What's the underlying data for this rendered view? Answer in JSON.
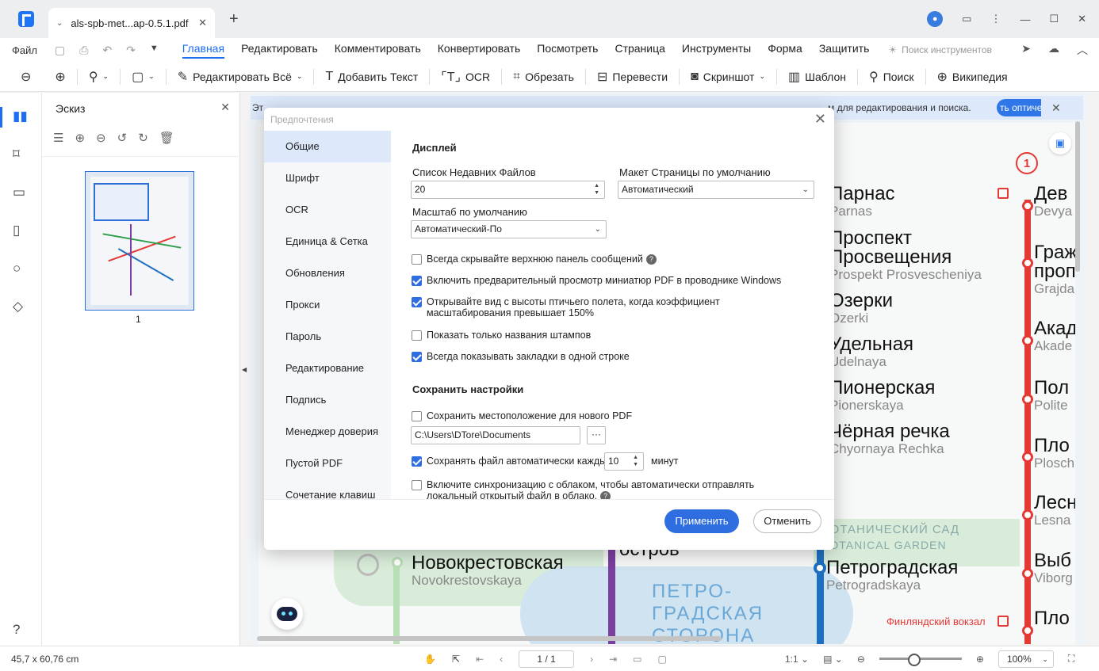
{
  "titlebar": {
    "tab_title": "als-spb-met...ap-0.5.1.pdf",
    "tab_close": "✕",
    "new_tab": "+"
  },
  "menubar": {
    "file": "Файл",
    "items": [
      "Главная",
      "Редактировать",
      "Комментировать",
      "Конвертировать",
      "Посмотреть",
      "Страница",
      "Инструменты",
      "Форма",
      "Защитить"
    ],
    "active_item": "Главная",
    "tool_search_placeholder": "Поиск инструментов"
  },
  "toolbar": {
    "edit_all": "Редактировать Всё",
    "add_text": "Добавить Текст",
    "ocr": "OCR",
    "crop": "Обрезать",
    "translate": "Перевести",
    "screenshot": "Скриншот",
    "template": "Шаблон",
    "search": "Поиск",
    "wiki": "Википедия"
  },
  "thumbnail_panel": {
    "title": "Эскиз",
    "page_number": "1"
  },
  "banner": {
    "text_start": "Эт",
    "text_end": "м для редактирования и поиска.",
    "button": "ть оптиче"
  },
  "map": {
    "line_number": "1",
    "stations_left": [
      {
        "ru": "Парнас",
        "lat": "Parnas"
      },
      {
        "ru": "Проспект",
        "ru2": "Просвещения",
        "lat": "Prospekt Prosvescheniya"
      },
      {
        "ru": "Озерки",
        "lat": "Ozerki"
      },
      {
        "ru": "Удельная",
        "lat": "Udelnaya"
      },
      {
        "ru": "Пионерская",
        "lat": "Pionerskaya"
      },
      {
        "ru": "Чёрная речка",
        "lat": "Chyornaya Rechka"
      }
    ],
    "stations_right": [
      {
        "ru": "Дев",
        "lat": "Devya"
      },
      {
        "ru": "Граж",
        "ru2": "проп",
        "lat": "Grajda"
      },
      {
        "ru": "Акад",
        "lat": "Akade"
      },
      {
        "ru": "Пол",
        "lat": "Polite"
      },
      {
        "ru": "Пло",
        "lat": "Plosch"
      },
      {
        "ru": "Лесн",
        "lat": "Lesna"
      },
      {
        "ru": "Выб",
        "lat": "Viborg"
      },
      {
        "ru": "Пло",
        "lat": ""
      }
    ],
    "botanical_ru": "БОТАНИЧЕСКИЙ САД",
    "botanical_en": "BOTANICAL GARDEN",
    "novokrest_ru": "Новокрестовская",
    "novokrest_lat": "Novokrestovskaya",
    "ostrov": "остров",
    "petrogradskaya_ru": "Петроградская",
    "petrogradskaya_lat": "Petrogradskaya",
    "district_1": "ПЕТРО-",
    "district_2": "ГРАДСКАЯ",
    "district_3": "СТОРОНА",
    "finland_station": "Финляндский вокзал"
  },
  "statusbar": {
    "page_size": "45,7 x 60,76 cm",
    "page_indicator": "1 / 1",
    "zoom": "100%",
    "zoom_slider_fraction": 0.35
  },
  "dialog": {
    "title": "Предпочтения",
    "nav": [
      "Общие",
      "Шрифт",
      "OCR",
      "Единица & Сетка",
      "Обновления",
      "Прокси",
      "Пароль",
      "Редактирование",
      "Подпись",
      "Менеджер доверия",
      "Пустой PDF",
      "Сочетание клавиш"
    ],
    "active_nav": "Общие",
    "display_section": "Дисплей",
    "recent_files_label": "Список Недавних Файлов",
    "recent_files_value": "20",
    "layout_label": "Макет Страницы по умолчанию",
    "layout_value": "Автоматический",
    "zoom_label": "Масштаб по умолчанию",
    "zoom_value": "Автоматический-По",
    "checkboxes": [
      {
        "label": "Всегда скрывайте верхнюю панель сообщений",
        "checked": false,
        "help": true
      },
      {
        "label": "Включить предварительный просмотр миниатюр PDF в проводнике Windows",
        "checked": true
      },
      {
        "label": "Открывайте вид с высоты птичьего полета, когда коэффициент масштабирования превышает 150%",
        "checked": true
      },
      {
        "label": "Показать только названия штампов",
        "checked": false
      },
      {
        "label": "Всегда показывать закладки в одной строке",
        "checked": true
      }
    ],
    "save_section": "Сохранить настройки",
    "save_location_label": "Сохранить местоположение для нового PDF",
    "save_location_checked": false,
    "save_path": "C:\\Users\\DTore\\Documents",
    "browse_button": "···",
    "autosave_label": "Сохранять файл автоматически каждые",
    "autosave_checked": true,
    "autosave_value": "10",
    "autosave_unit": "минут",
    "cloud_sync_label": "Включите синхронизацию с облаком, чтобы автоматически отправлять локальный открытый файл в облако.",
    "cloud_sync_checked": false,
    "apply_button": "Применить",
    "cancel_button": "Отменить"
  },
  "colors": {
    "accent": "#2f6ee0",
    "line_red": "#e53935",
    "line_purple": "#7b3fa0",
    "line_blue": "#1e6fc0"
  }
}
